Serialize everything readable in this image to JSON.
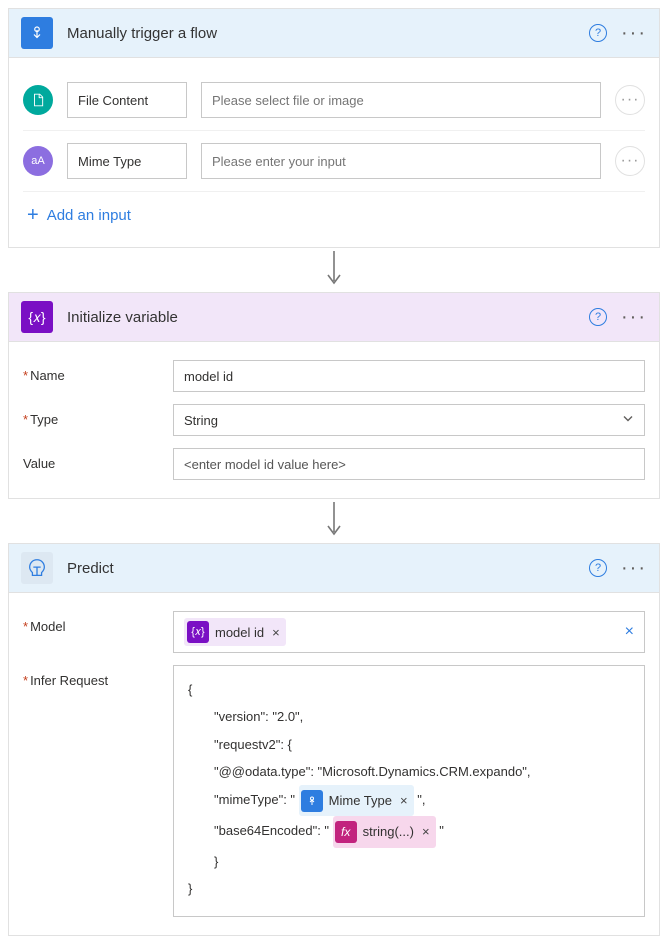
{
  "trigger": {
    "title": "Manually trigger a flow",
    "inputs": [
      {
        "label": "File Content",
        "placeholder": "Please select file or image",
        "icon": "file"
      },
      {
        "label": "Mime Type",
        "placeholder": "Please enter your input",
        "icon": "text"
      }
    ],
    "addInput": "Add an input"
  },
  "initVar": {
    "title": "Initialize variable",
    "nameLabel": "Name",
    "nameValue": "model id",
    "typeLabel": "Type",
    "typeValue": "String",
    "valueLabel": "Value",
    "valuePlaceholder": "<enter model id value here>"
  },
  "predict": {
    "title": "Predict",
    "modelLabel": "Model",
    "modelToken": "model id",
    "inferLabel": "Infer Request",
    "code": {
      "l0": "{",
      "version": "\"version\": \"2.0\",",
      "reqv2": "\"requestv2\": {",
      "odata": "\"@@odata.type\": \"Microsoft.Dynamics.CRM.expando\",",
      "mimePre": "\"mimeType\": \"",
      "mimeToken": "Mime Type",
      "mimePost": "\",",
      "b64Pre": "\"base64Encoded\": \"",
      "fxToken": "string(...)",
      "b64Post": "\"",
      "close1": "}",
      "close0": "}"
    }
  }
}
